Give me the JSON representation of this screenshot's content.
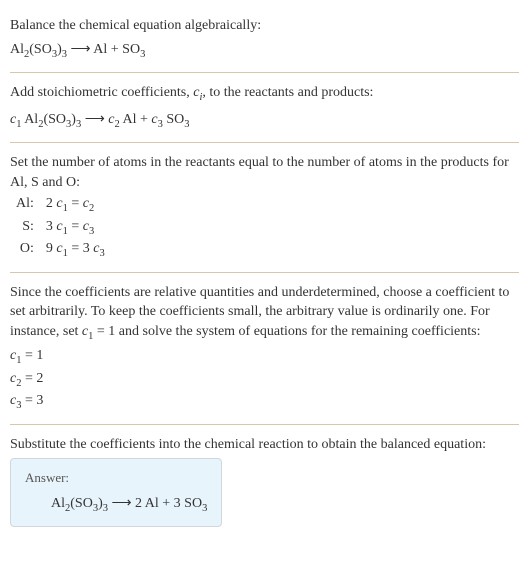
{
  "section1": {
    "intro": "Balance the chemical equation algebraically:",
    "equation_html": "Al<sub>2</sub>(SO<sub>3</sub>)<sub>3</sub>  ⟶  Al + SO<sub>3</sub>"
  },
  "section2": {
    "intro_html": "Add stoichiometric coefficients, <span class=\"italic\">c<sub>i</sub></span>, to the reactants and products:",
    "equation_html": "<span class=\"italic\">c</span><sub>1</sub> Al<sub>2</sub>(SO<sub>3</sub>)<sub>3</sub>  ⟶  <span class=\"italic\">c</span><sub>2</sub> Al + <span class=\"italic\">c</span><sub>3</sub> SO<sub>3</sub>"
  },
  "section3": {
    "intro": "Set the number of atoms in the reactants equal to the number of atoms in the products for Al, S and O:",
    "rows": [
      {
        "label": "Al:",
        "eq_html": "2 <span class=\"italic\">c</span><sub>1</sub> = <span class=\"italic\">c</span><sub>2</sub>"
      },
      {
        "label": "S:",
        "eq_html": "3 <span class=\"italic\">c</span><sub>1</sub> = <span class=\"italic\">c</span><sub>3</sub>"
      },
      {
        "label": "O:",
        "eq_html": "9 <span class=\"italic\">c</span><sub>1</sub> = 3 <span class=\"italic\">c</span><sub>3</sub>"
      }
    ]
  },
  "section4": {
    "intro_html": "Since the coefficients are relative quantities and underdetermined, choose a coefficient to set arbitrarily. To keep the coefficients small, the arbitrary value is ordinarily one. For instance, set <span class=\"italic\">c</span><sub>1</sub> = 1 and solve the system of equations for the remaining coefficients:",
    "coeffs": [
      {
        "html": "<span class=\"italic\">c</span><sub>1</sub> = 1"
      },
      {
        "html": "<span class=\"italic\">c</span><sub>2</sub> = 2"
      },
      {
        "html": "<span class=\"italic\">c</span><sub>3</sub> = 3"
      }
    ]
  },
  "section5": {
    "intro": "Substitute the coefficients into the chemical reaction to obtain the balanced equation:",
    "answer_label": "Answer:",
    "answer_equation_html": "Al<sub>2</sub>(SO<sub>3</sub>)<sub>3</sub>  ⟶  2 Al + 3 SO<sub>3</sub>"
  }
}
